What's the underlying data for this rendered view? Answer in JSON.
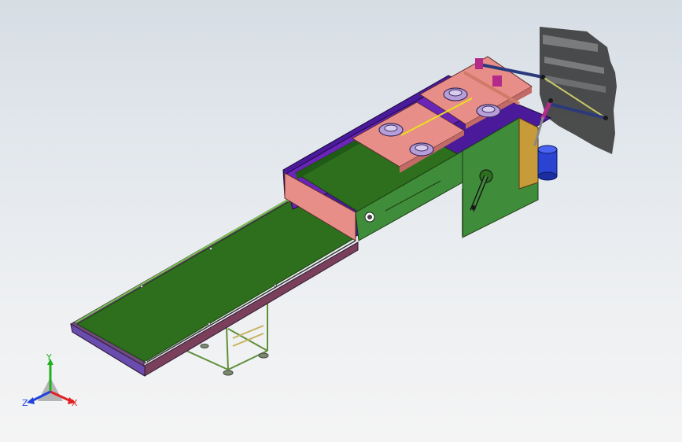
{
  "viewport": {
    "background_top": "#d6dde4",
    "background_bottom": "#f4f4f4"
  },
  "model": {
    "belt_color": "#2e6f1e",
    "frame_color": "#7c4a8e",
    "frame_purple_color": "#6a24b8",
    "salmon_color": "#e88e88",
    "green_panel_color": "#3f8c3a",
    "blue_cylinder_color": "#2a43d0"
  },
  "triad": {
    "x_label": "X",
    "y_label": "Y",
    "z_label": "Z",
    "x_color": "#e02020",
    "y_color": "#20b020",
    "z_color": "#2040e0"
  }
}
